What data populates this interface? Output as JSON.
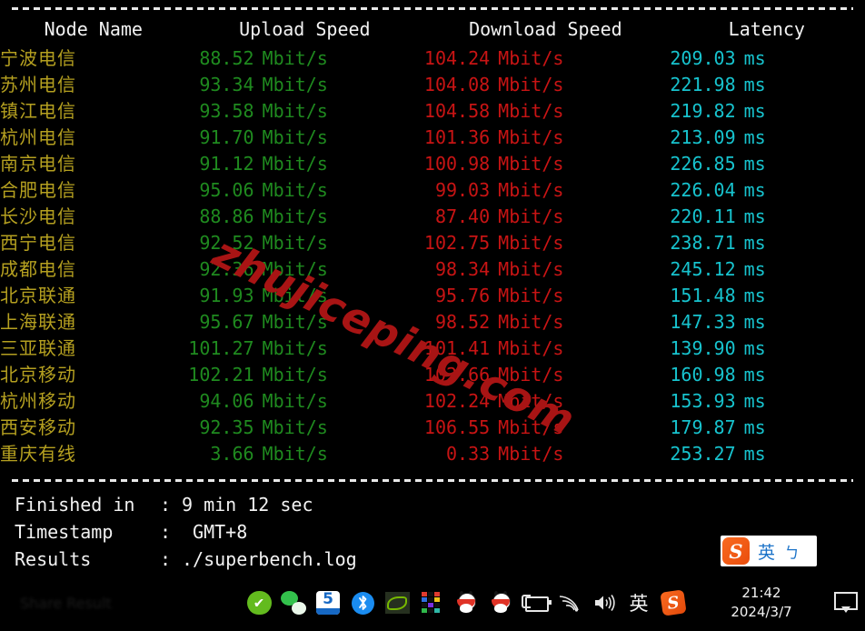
{
  "terminal": {
    "columns": [
      "Node Name",
      "Upload Speed",
      "Download Speed",
      "Latency"
    ],
    "units": {
      "speed": "Mbit/s",
      "latency": "ms"
    },
    "rows": [
      {
        "node": "宁波电信",
        "upload": "88.52",
        "download": "104.24",
        "latency": "209.03"
      },
      {
        "node": "苏州电信",
        "upload": "93.34",
        "download": "104.08",
        "latency": "221.98"
      },
      {
        "node": "镇江电信",
        "upload": "93.58",
        "download": "104.58",
        "latency": "219.82"
      },
      {
        "node": "杭州电信",
        "upload": "91.70",
        "download": "101.36",
        "latency": "213.09"
      },
      {
        "node": "南京电信",
        "upload": "91.12",
        "download": "100.98",
        "latency": "226.85"
      },
      {
        "node": "合肥电信",
        "upload": "95.06",
        "download": "99.03",
        "latency": "226.04"
      },
      {
        "node": "长沙电信",
        "upload": "88.86",
        "download": "87.40",
        "latency": "220.11"
      },
      {
        "node": "西宁电信",
        "upload": "92.52",
        "download": "102.75",
        "latency": "238.71"
      },
      {
        "node": "成都电信",
        "upload": "92.36",
        "download": "98.34",
        "latency": "245.12"
      },
      {
        "node": "北京联通",
        "upload": "91.93",
        "download": "95.76",
        "latency": "151.48"
      },
      {
        "node": "上海联通",
        "upload": "95.67",
        "download": "98.52",
        "latency": "147.33"
      },
      {
        "node": "三亚联通",
        "upload": "101.27",
        "download": "101.41",
        "latency": "139.90"
      },
      {
        "node": "北京移动",
        "upload": "102.21",
        "download": "102.66",
        "latency": "160.98"
      },
      {
        "node": "杭州移动",
        "upload": "94.06",
        "download": "102.24",
        "latency": "153.93"
      },
      {
        "node": "西安移动",
        "upload": "92.35",
        "download": "106.55",
        "latency": "179.87"
      },
      {
        "node": "重庆有线",
        "upload": "3.66",
        "download": "0.33",
        "latency": "253.27"
      }
    ],
    "summary": [
      {
        "label": "Finished in",
        "colon": ":",
        "value": "9 min 12 sec"
      },
      {
        "label": "Timestamp",
        "colon": ":",
        "value": " GMT+8"
      },
      {
        "label": "Results",
        "colon": ":",
        "value": "./superbench.log"
      }
    ],
    "colors": {
      "node": "#b5a020",
      "upload": "#1f8a1f",
      "download": "#c81414",
      "latency": "#17c3ce",
      "header": "#f2f2f2",
      "background": "#000000"
    }
  },
  "watermark": {
    "text": "zhujiceping.com",
    "color": "#a81414"
  },
  "ime_bar": {
    "logo": "S",
    "mode": "英",
    "keyboard": "ㄅ"
  },
  "taskbar": {
    "ghost_text": "Share  Result",
    "tray": [
      {
        "name": "security-check-icon",
        "glyph": "✔"
      },
      {
        "name": "wechat-icon",
        "glyph": ""
      },
      {
        "name": "driver-booster-5-icon",
        "glyph": "5"
      },
      {
        "name": "bluetooth-icon",
        "glyph": "✳"
      },
      {
        "name": "nvidia-icon",
        "glyph": ""
      },
      {
        "name": "color-grid-icon",
        "glyph": ""
      },
      {
        "name": "qq-icon-1",
        "glyph": ""
      },
      {
        "name": "qq-icon-2",
        "glyph": ""
      },
      {
        "name": "battery-charging-icon",
        "glyph": ""
      },
      {
        "name": "wifi-icon",
        "glyph": ""
      },
      {
        "name": "volume-icon",
        "glyph": ""
      },
      {
        "name": "ime-english-icon",
        "glyph": "英"
      },
      {
        "name": "sogou-icon",
        "glyph": "S"
      }
    ],
    "clock": {
      "time": "21:42",
      "date": "2024/3/7"
    }
  }
}
